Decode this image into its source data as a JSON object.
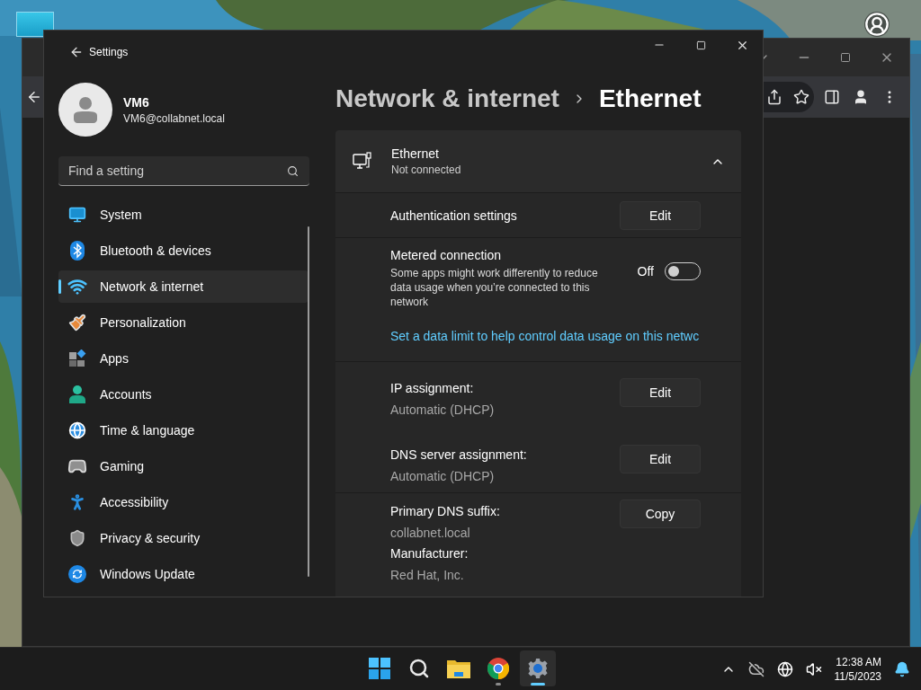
{
  "settings_window": {
    "title": "Settings",
    "user": {
      "name": "VM6",
      "email": "VM6@collabnet.local"
    },
    "search": {
      "placeholder": "Find a setting"
    },
    "nav": [
      {
        "kind": "system",
        "label": "System",
        "selected": false
      },
      {
        "kind": "bluetooth",
        "label": "Bluetooth & devices",
        "selected": false
      },
      {
        "kind": "network",
        "label": "Network & internet",
        "selected": true
      },
      {
        "kind": "personalization",
        "label": "Personalization",
        "selected": false
      },
      {
        "kind": "apps",
        "label": "Apps",
        "selected": false
      },
      {
        "kind": "accounts",
        "label": "Accounts",
        "selected": false
      },
      {
        "kind": "time",
        "label": "Time & language",
        "selected": false
      },
      {
        "kind": "gaming",
        "label": "Gaming",
        "selected": false
      },
      {
        "kind": "accessibility",
        "label": "Accessibility",
        "selected": false
      },
      {
        "kind": "privacy",
        "label": "Privacy & security",
        "selected": false
      },
      {
        "kind": "update",
        "label": "Windows Update",
        "selected": false
      }
    ],
    "breadcrumb": {
      "parent": "Network & internet",
      "current": "Ethernet"
    },
    "adapter": {
      "name": "Ethernet",
      "status": "Not connected",
      "expanded": true
    },
    "sections": [
      {
        "rows": [
          {
            "kind": "button",
            "label": "Authentication settings",
            "button": "Edit"
          }
        ]
      },
      {
        "rows": [
          {
            "kind": "toggle",
            "label": "Metered connection",
            "description": "Some apps might work differently to reduce data usage when you’re connected to this network",
            "state_text": "Off",
            "on": false,
            "link": "Set a data limit to help control data usage on this netwc"
          }
        ]
      },
      {
        "rows": [
          {
            "kind": "property",
            "label": "IP assignment:",
            "value": "Automatic (DHCP)",
            "button": "Edit"
          },
          {
            "kind": "property",
            "label": "DNS server assignment:",
            "value": "Automatic (DHCP)",
            "button": "Edit"
          }
        ]
      },
      {
        "rows": [
          {
            "kind": "info",
            "items": [
              {
                "label": "Primary DNS suffix:",
                "value": "collabnet.local"
              },
              {
                "label": "Manufacturer:",
                "value": "Red Hat, Inc."
              }
            ],
            "button": "Copy"
          }
        ]
      }
    ]
  },
  "taskbar": {
    "apps": [
      {
        "kind": "start",
        "selected": false,
        "running": false
      },
      {
        "kind": "search",
        "selected": false,
        "running": false
      },
      {
        "kind": "explorer",
        "selected": false,
        "running": false
      },
      {
        "kind": "chrome",
        "selected": false,
        "running": true
      },
      {
        "kind": "settings",
        "selected": true,
        "running": true
      }
    ],
    "clock": {
      "time": "12:38 AM",
      "date": "11/5/2023"
    }
  }
}
